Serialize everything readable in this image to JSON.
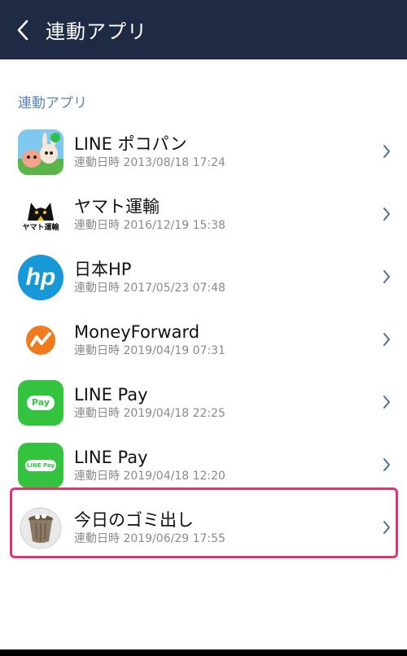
{
  "header": {
    "title": "連動アプリ"
  },
  "section": {
    "label": "連動アプリ"
  },
  "colors": {
    "header_bg": "#1f2a44",
    "section_label": "#5e83b8",
    "highlight": "#e6316e",
    "chevron": "#4a6ea8"
  },
  "apps": [
    {
      "name": "LINE ポコパン",
      "date": "連動日時 2013/08/18 17:24",
      "icon": "pokopang-icon"
    },
    {
      "name": "ヤマト運輸",
      "date": "連動日時 2016/12/19 15:38",
      "icon": "yamato-cat-icon",
      "icon_text": "ヤマト運輸"
    },
    {
      "name": "日本HP",
      "date": "連動日時 2017/05/23 07:48",
      "icon": "hp-logo-icon",
      "icon_text": "hp"
    },
    {
      "name": "MoneyForward",
      "date": "連動日時 2019/04/19 07:31",
      "icon": "moneyforward-icon"
    },
    {
      "name": "LINE Pay",
      "date": "連動日時 2019/04/18 22:25",
      "icon": "line-pay-icon",
      "icon_text": "Pay"
    },
    {
      "name": "LINE Pay",
      "date": "連動日時 2019/04/18 12:20",
      "icon": "line-pay-icon",
      "icon_text": "LINE Pay"
    },
    {
      "name": "今日のゴミ出し",
      "date": "連動日時 2019/06/29 17:55",
      "icon": "trash-can-icon"
    }
  ]
}
